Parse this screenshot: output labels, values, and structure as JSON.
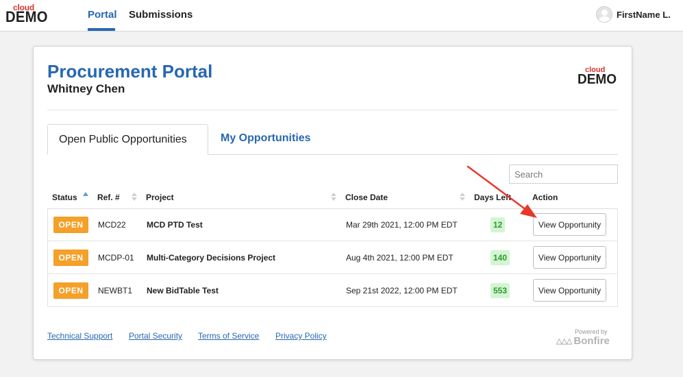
{
  "topbar": {
    "logo_top": "cloud",
    "logo_bottom": "DEMO",
    "nav": [
      {
        "label": "Portal",
        "active": true
      },
      {
        "label": "Submissions",
        "active": false
      }
    ],
    "user_name": "FirstName L."
  },
  "card": {
    "title": "Procurement Portal",
    "subtitle": "Whitney Chen",
    "logo_top": "cloud",
    "logo_bottom": "DEMO",
    "tabs": [
      {
        "label": "Open Public Opportunities",
        "active": true
      },
      {
        "label": "My Opportunities",
        "active": false
      }
    ],
    "search": {
      "placeholder": "Search",
      "value": ""
    },
    "columns": {
      "status": "Status",
      "ref": "Ref. #",
      "project": "Project",
      "close_date": "Close Date",
      "days_left": "Days Left",
      "action": "Action"
    },
    "rows": [
      {
        "status": "OPEN",
        "ref": "MCD22",
        "project": "MCD PTD Test",
        "close_date": "Mar 29th 2021, 12:00 PM EDT",
        "days_left": "12",
        "action": "View Opportunity"
      },
      {
        "status": "OPEN",
        "ref": "MCDP-01",
        "project": "Multi-Category Decisions Project",
        "close_date": "Aug 4th 2021, 12:00 PM EDT",
        "days_left": "140",
        "action": "View Opportunity"
      },
      {
        "status": "OPEN",
        "ref": "NEWBT1",
        "project": "New BidTable Test",
        "close_date": "Sep 21st 2022, 12:00 PM EDT",
        "days_left": "553",
        "action": "View Opportunity"
      }
    ],
    "footer_links": [
      "Technical Support",
      "Portal Security",
      "Terms of Service",
      "Privacy Policy"
    ],
    "powered_by": "Powered by",
    "brand": "Bonfire"
  },
  "colors": {
    "accent": "#2767b0",
    "open_badge": "#f4a029",
    "days_bg": "#d3f5d3",
    "days_text": "#2b9a2b",
    "arrow": "#e8382b"
  }
}
